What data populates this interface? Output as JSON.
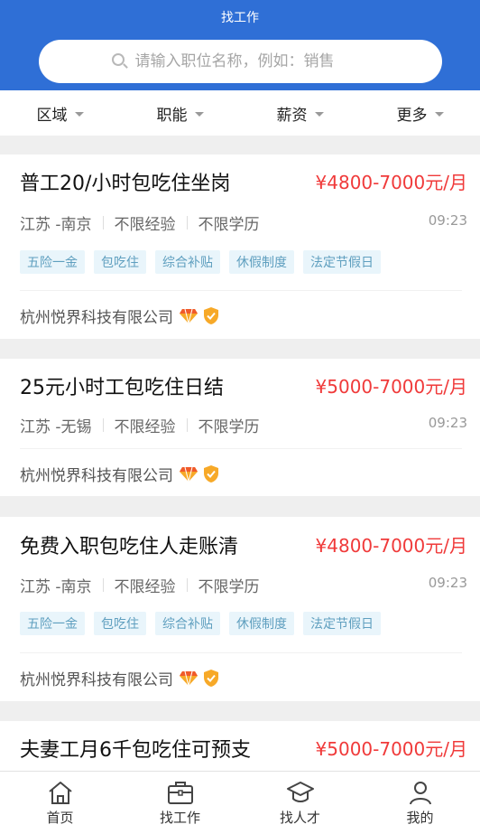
{
  "header": {
    "title": "找工作"
  },
  "search": {
    "placeholder": "请输入职位名称，例如：销售"
  },
  "filters": [
    {
      "label": "区域"
    },
    {
      "label": "职能"
    },
    {
      "label": "薪资"
    },
    {
      "label": "更多"
    }
  ],
  "jobs": [
    {
      "title": "普工20/小时包吃住坐岗",
      "salary": "¥4800-7000元/月",
      "location": "江苏 -南京",
      "experience": "不限经验",
      "education": "不限学历",
      "time": "09:23",
      "tags": [
        "五险一金",
        "包吃住",
        "综合补贴",
        "休假制度",
        "法定节假日"
      ],
      "company": "杭州悦界科技有限公司"
    },
    {
      "title": "25元小时工包吃住日结",
      "salary": "¥5000-7000元/月",
      "location": "江苏 -无锡",
      "experience": "不限经验",
      "education": "不限学历",
      "time": "09:23",
      "tags": [],
      "company": "杭州悦界科技有限公司"
    },
    {
      "title": "免费入职包吃住人走账清",
      "salary": "¥4800-7000元/月",
      "location": "江苏 -南京",
      "experience": "不限经验",
      "education": "不限学历",
      "time": "09:23",
      "tags": [
        "五险一金",
        "包吃住",
        "综合补贴",
        "休假制度",
        "法定节假日"
      ],
      "company": "杭州悦界科技有限公司"
    },
    {
      "title": "夫妻工月6千包吃住可预支",
      "salary": "¥5000-7000元/月"
    }
  ],
  "tabbar": [
    {
      "label": "首页",
      "icon": "home-icon"
    },
    {
      "label": "找工作",
      "icon": "briefcase-icon"
    },
    {
      "label": "找人才",
      "icon": "graduation-cap-icon"
    },
    {
      "label": "我的",
      "icon": "user-icon"
    }
  ],
  "colors": {
    "primary": "#2f6fd6",
    "salary": "#f03a3a",
    "tag_bg": "#e9f5fb",
    "tag_text": "#5f9fbf"
  }
}
